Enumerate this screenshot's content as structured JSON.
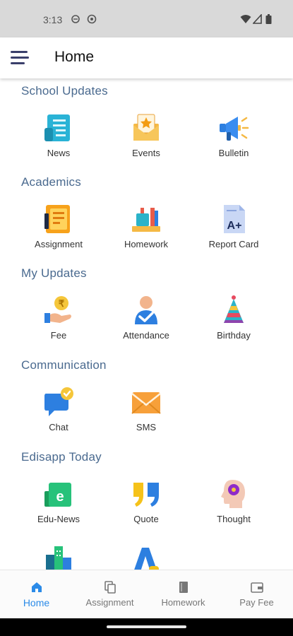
{
  "status_bar": {
    "time": "3:13"
  },
  "app_bar": {
    "title": "Home"
  },
  "sections": [
    {
      "title": "School Updates",
      "items": [
        {
          "label": "News",
          "icon": "news-icon"
        },
        {
          "label": "Events",
          "icon": "events-icon"
        },
        {
          "label": "Bulletin",
          "icon": "bulletin-icon"
        }
      ]
    },
    {
      "title": "Academics",
      "items": [
        {
          "label": "Assignment",
          "icon": "assignment-icon"
        },
        {
          "label": "Homework",
          "icon": "homework-icon"
        },
        {
          "label": "Report Card",
          "icon": "report-card-icon"
        }
      ]
    },
    {
      "title": "My Updates",
      "items": [
        {
          "label": "Fee",
          "icon": "fee-icon"
        },
        {
          "label": "Attendance",
          "icon": "attendance-icon"
        },
        {
          "label": "Birthday",
          "icon": "birthday-icon"
        }
      ]
    },
    {
      "title": "Communication",
      "items": [
        {
          "label": "Chat",
          "icon": "chat-icon"
        },
        {
          "label": "SMS",
          "icon": "sms-icon"
        }
      ]
    },
    {
      "title": "Edisapp Today",
      "items": [
        {
          "label": "Edu-News",
          "icon": "edu-news-icon"
        },
        {
          "label": "Quote",
          "icon": "quote-icon"
        },
        {
          "label": "Thought",
          "icon": "thought-icon"
        }
      ]
    }
  ],
  "bottom_nav": [
    {
      "label": "Home",
      "icon": "home-icon",
      "active": true
    },
    {
      "label": "Assignment",
      "icon": "copy-icon"
    },
    {
      "label": "Homework",
      "icon": "book-icon"
    },
    {
      "label": "Pay Fee",
      "icon": "wallet-icon"
    }
  ],
  "colors": {
    "accent": "#2b8be8",
    "section_title": "#4a6a8f",
    "hamburger": "#3a3f6b"
  }
}
